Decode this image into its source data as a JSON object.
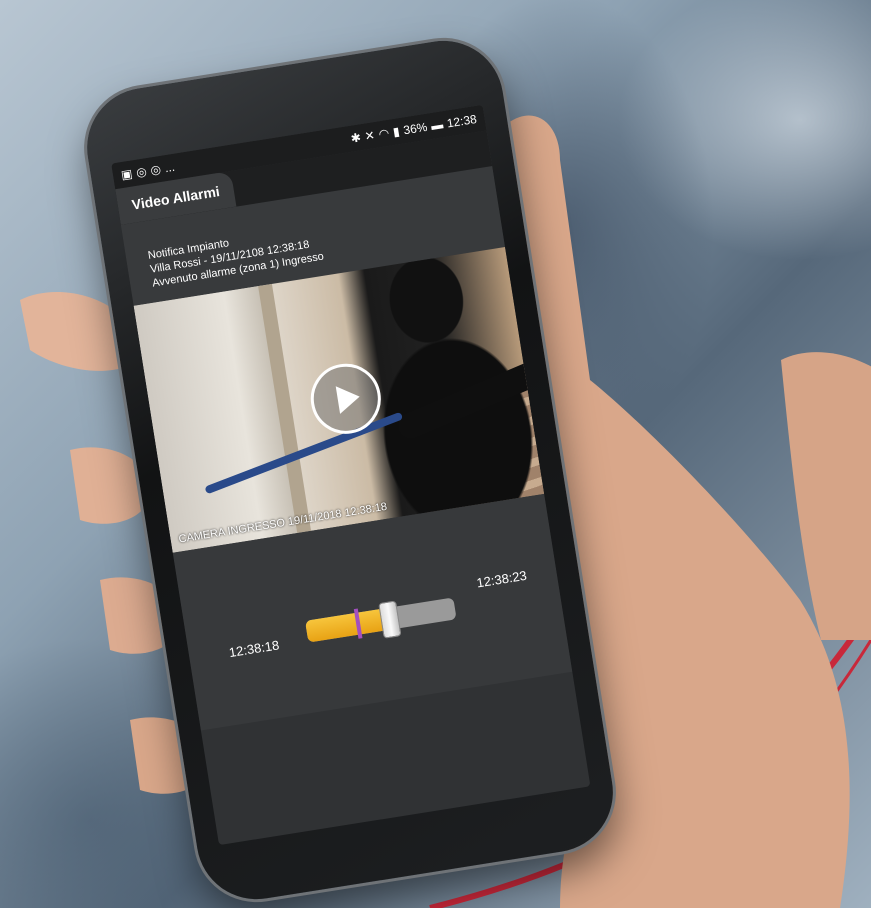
{
  "status_bar": {
    "left_icons": [
      "image-icon",
      "camera-icon",
      "camera-icon"
    ],
    "left_extra": "...",
    "icons": [
      "bluetooth-icon",
      "mute-icon",
      "wifi-icon",
      "signal-icon"
    ],
    "battery": "36%",
    "time": "12:38"
  },
  "tab": {
    "label": "Video Allarmi"
  },
  "notification": {
    "title": "Notifica Impianto",
    "line1": "Villa Rossi  - 19/11/2108 12:38:18",
    "line2": "Avvenuto allarme (zona 1) Ingresso"
  },
  "video": {
    "caption": "CAMERA INGRESSO  19/11/2018 12:38:18"
  },
  "player": {
    "time_start": "12:38:18",
    "time_end": "12:38:23",
    "progress": 0.55,
    "marker": 0.33
  },
  "colors": {
    "accent": "#E8A214",
    "marker": "#A24FBF",
    "brand_curve": "#C8283A"
  }
}
